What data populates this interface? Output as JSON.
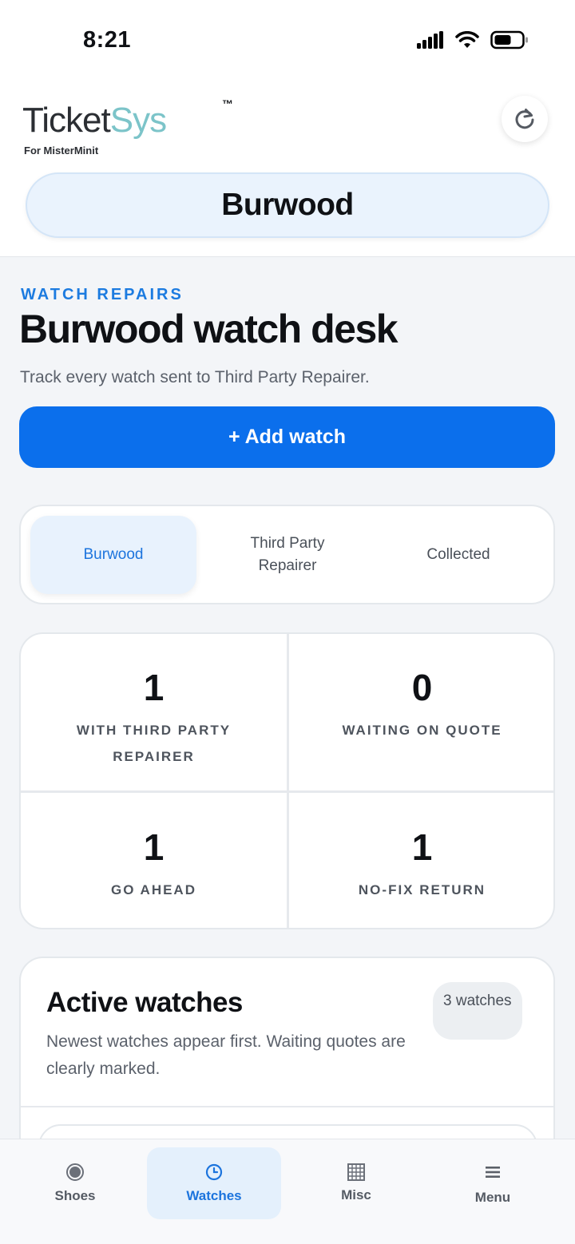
{
  "status_bar": {
    "time": "8:21"
  },
  "header": {
    "logo_prefix": "Ticket",
    "logo_suffix": "Sys",
    "trademark": "™",
    "logo_subtitle": "For MisterMinit",
    "store_name": "Burwood"
  },
  "page": {
    "eyebrow": "WATCH REPAIRS",
    "title": "Burwood watch desk",
    "subtitle": "Track every watch sent to Third Party Repairer.",
    "add_button": "+ Add watch"
  },
  "segments": [
    {
      "label": "Burwood",
      "active": true
    },
    {
      "label": "Third Party Repairer",
      "active": false
    },
    {
      "label": "Collected",
      "active": false
    }
  ],
  "stats": [
    {
      "value": "1",
      "label": "WITH THIRD PARTY REPAIRER"
    },
    {
      "value": "0",
      "label": "WAITING ON QUOTE"
    },
    {
      "value": "1",
      "label": "GO AHEAD"
    },
    {
      "value": "1",
      "label": "NO-FIX RETURN"
    }
  ],
  "active_watches": {
    "title": "Active watches",
    "description": "Newest watches appear first. Waiting quotes are clearly marked.",
    "count_badge": "3 watches"
  },
  "bottom_nav": [
    {
      "label": "Shoes",
      "icon": "record-icon",
      "active": false
    },
    {
      "label": "Watches",
      "icon": "clock-icon",
      "active": true
    },
    {
      "label": "Misc",
      "icon": "grid-icon",
      "active": false
    },
    {
      "label": "Menu",
      "icon": "hamburger-icon",
      "active": false
    }
  ],
  "colors": {
    "accent": "#0b6fec",
    "active_tab_bg": "#e8f2fd",
    "logo_teal": "#7cc4c9"
  }
}
